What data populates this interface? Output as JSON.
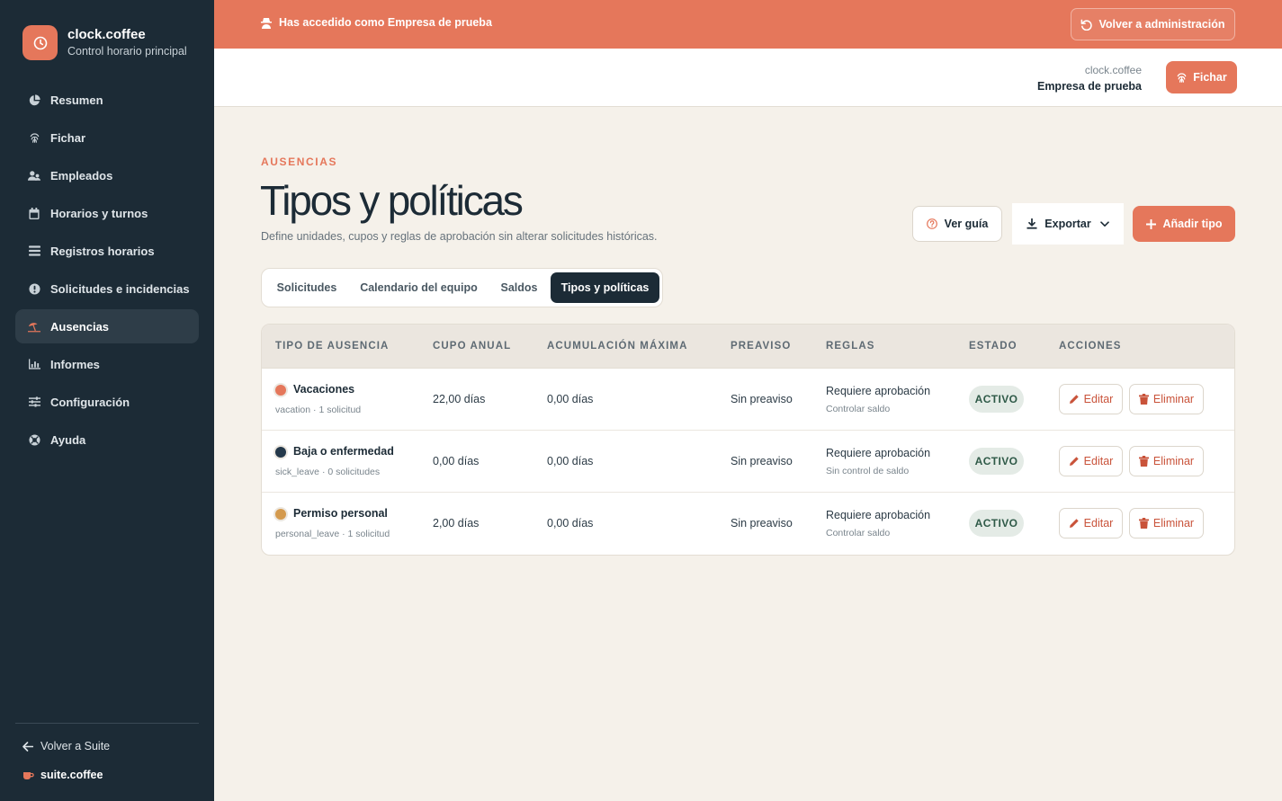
{
  "sidebar": {
    "brand_name": "clock.coffee",
    "brand_sub": "Control horario principal",
    "items": [
      {
        "label": "Resumen",
        "icon": "pie-chart-icon"
      },
      {
        "label": "Fichar",
        "icon": "fingerprint-icon"
      },
      {
        "label": "Empleados",
        "icon": "users-icon"
      },
      {
        "label": "Horarios y turnos",
        "icon": "calendar-icon"
      },
      {
        "label": "Registros horarios",
        "icon": "list-icon"
      },
      {
        "label": "Solicitudes e incidencias",
        "icon": "alert-circle-icon"
      },
      {
        "label": "Ausencias",
        "icon": "umbrella-beach-icon",
        "active": true
      },
      {
        "label": "Informes",
        "icon": "bar-chart-icon"
      },
      {
        "label": "Configuración",
        "icon": "sliders-icon"
      },
      {
        "label": "Ayuda",
        "icon": "lifebuoy-icon"
      }
    ],
    "back_label": "Volver a Suite",
    "suite_label": "suite.coffee"
  },
  "banner": {
    "text": "Has accedido como Empresa de prueba",
    "button": "Volver a administración"
  },
  "header": {
    "app": "clock.coffee",
    "company": "Empresa de prueba",
    "fichar": "Fichar"
  },
  "page": {
    "eyebrow": "AUSENCIAS",
    "title": "Tipos y políticas",
    "description": "Define unidades, cupos y reglas de aprobación sin alterar solicitudes históricas.",
    "guide": "Ver guía",
    "export": "Exportar",
    "add": "Añadir tipo"
  },
  "tabs": [
    "Solicitudes",
    "Calendario del equipo",
    "Saldos",
    "Tipos y políticas"
  ],
  "table": {
    "headers": [
      "TIPO DE AUSENCIA",
      "CUPO ANUAL",
      "ACUMULACIÓN MÁXIMA",
      "PREAVISO",
      "REGLAS",
      "ESTADO",
      "ACCIONES"
    ],
    "rows": [
      {
        "color": "#e5775b",
        "name": "Vacaciones",
        "sub": "vacation · 1 solicitud",
        "quota": "22,00 días",
        "accum": "0,00 días",
        "notice": "Sin preaviso",
        "rule": "Requiere aprobación",
        "rule_sub": "Controlar saldo",
        "status": "ACTIVO"
      },
      {
        "color": "#24384a",
        "name": "Baja o enfermedad",
        "sub": "sick_leave · 0 solicitudes",
        "quota": "0,00 días",
        "accum": "0,00 días",
        "notice": "Sin preaviso",
        "rule": "Requiere aprobación",
        "rule_sub": "Sin control de saldo",
        "status": "ACTIVO"
      },
      {
        "color": "#d49a4e",
        "name": "Permiso personal",
        "sub": "personal_leave · 1 solicitud",
        "quota": "2,00 días",
        "accum": "0,00 días",
        "notice": "Sin preaviso",
        "rule": "Requiere aprobación",
        "rule_sub": "Controlar saldo",
        "status": "ACTIVO"
      }
    ],
    "edit": "Editar",
    "delete": "Eliminar"
  }
}
